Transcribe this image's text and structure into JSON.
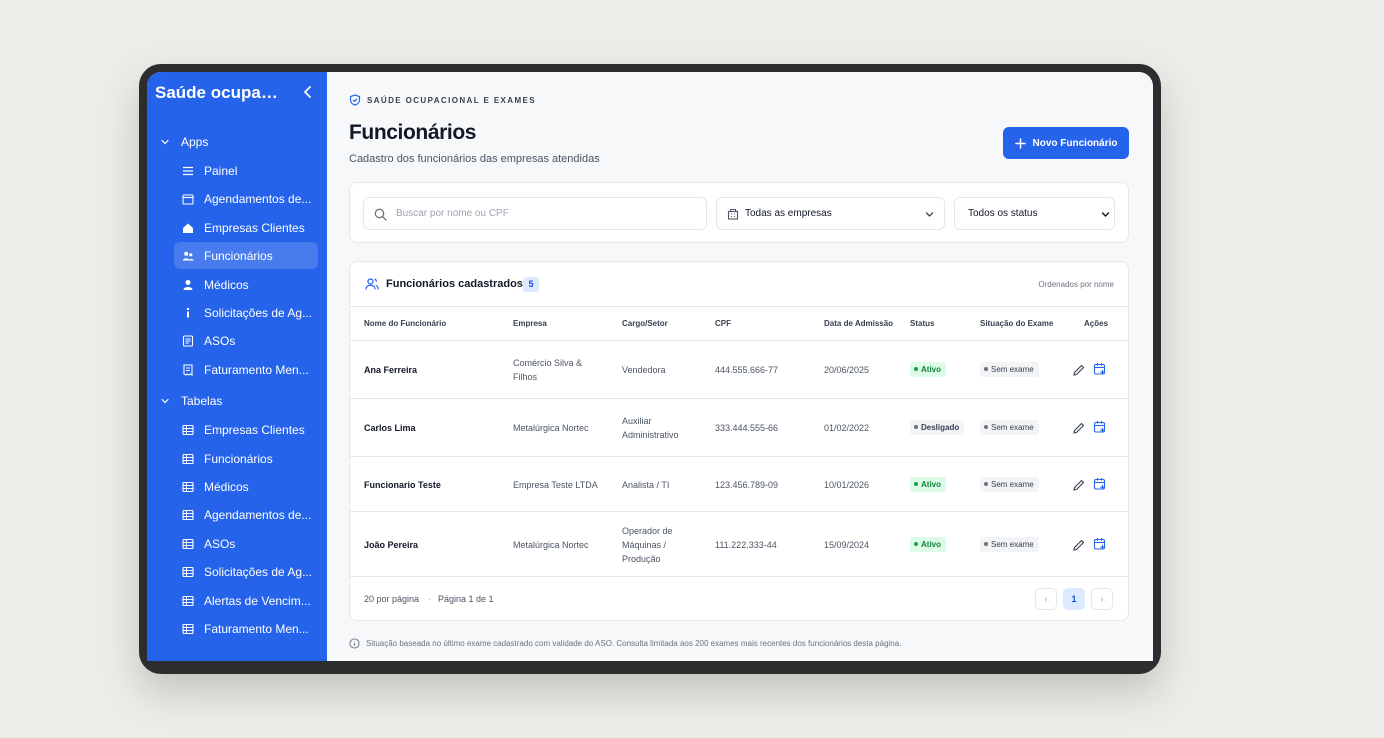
{
  "sidebar": {
    "title": "Saúde ocupaci...",
    "groups": [
      {
        "label": "Apps",
        "items": [
          {
            "label": "Painel",
            "icon": "list-icon"
          },
          {
            "label": "Agendamentos de...",
            "icon": "calendar-icon"
          },
          {
            "label": "Empresas Clientes",
            "icon": "home-icon"
          },
          {
            "label": "Funcionários",
            "icon": "users-icon",
            "active": true
          },
          {
            "label": "Médicos",
            "icon": "user-icon"
          },
          {
            "label": "Solicitações de Ag...",
            "icon": "info-icon"
          },
          {
            "label": "ASOs",
            "icon": "document-icon"
          },
          {
            "label": "Faturamento Men...",
            "icon": "receipt-icon"
          }
        ]
      },
      {
        "label": "Tabelas",
        "items": [
          {
            "label": "Empresas Clientes",
            "icon": "table-icon"
          },
          {
            "label": "Funcionários",
            "icon": "table-icon"
          },
          {
            "label": "Médicos",
            "icon": "table-icon"
          },
          {
            "label": "Agendamentos de...",
            "icon": "table-icon"
          },
          {
            "label": "ASOs",
            "icon": "table-icon"
          },
          {
            "label": "Solicitações de Ag...",
            "icon": "table-icon"
          },
          {
            "label": "Alertas de Vencim...",
            "icon": "table-icon"
          },
          {
            "label": "Faturamento Men...",
            "icon": "table-icon"
          }
        ]
      }
    ]
  },
  "header": {
    "eyebrow": "SAÚDE OCUPACIONAL E EXAMES",
    "title": "Funcionários",
    "subtitle": "Cadastro dos funcionários das empresas atendidas",
    "new_button": "Novo Funcionário"
  },
  "filters": {
    "search_placeholder": "Buscar por nome ou CPF",
    "company": "Todas as empresas",
    "status": "Todos os status"
  },
  "table": {
    "title": "Funcionários cadastrados",
    "count": "5",
    "order_note": "Ordenados por nome",
    "columns": [
      "Nome do Funcionário",
      "Empresa",
      "Cargo/Setor",
      "CPF",
      "Data de Admissão",
      "Status",
      "Situação do Exame",
      "Ações"
    ],
    "rows": [
      {
        "name": "Ana Ferreira",
        "company": [
          "Comércio Silva &",
          "Filhos"
        ],
        "role": [
          "Vendedora"
        ],
        "cpf": "444.555.666-77",
        "admission": "20/06/2025",
        "status": "Ativo",
        "status_kind": "active",
        "exam": "Sem exame"
      },
      {
        "name": "Carlos Lima",
        "company": [
          "Metalúrgica Nortec"
        ],
        "role": [
          "Auxiliar",
          "Administrativo"
        ],
        "cpf": "333.444.555-66",
        "admission": "01/02/2022",
        "status": "Desligado",
        "status_kind": "off",
        "exam": "Sem exame"
      },
      {
        "name": "Funcionario Teste",
        "company": [
          "Empresa Teste LTDA"
        ],
        "role": [
          "Analista / TI"
        ],
        "cpf": "123.456.789-09",
        "admission": "10/01/2026",
        "status": "Ativo",
        "status_kind": "active",
        "exam": "Sem exame"
      },
      {
        "name": "João Pereira",
        "company": [
          "Metalúrgica Nortec"
        ],
        "role": [
          "Operador de",
          "Máquinas /",
          "Produção"
        ],
        "cpf": "111.222.333-44",
        "admission": "15/09/2024",
        "status": "Ativo",
        "status_kind": "active",
        "exam": "Sem exame"
      }
    ],
    "per_page": "20 por página",
    "separator": "·",
    "page_info": "Página 1 de 1",
    "current_page": "1",
    "prev": "‹",
    "next": "›"
  },
  "note": "Situação baseada no último exame cadastrado com validade do ASO. Consulta limitada aos 200 exames mais recentes dos funcionários desta página.",
  "colors": {
    "accent": "#2563eb",
    "active_green": "#15803d"
  }
}
